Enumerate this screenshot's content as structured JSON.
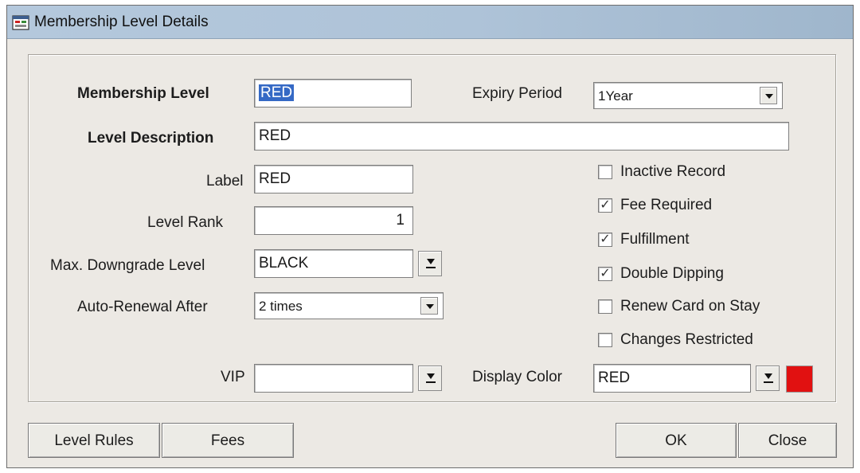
{
  "window": {
    "title": "Membership Level Details"
  },
  "form": {
    "membership_level": {
      "label": "Membership Level",
      "value": "RED"
    },
    "expiry_period": {
      "label": "Expiry Period",
      "value": "1Year"
    },
    "level_description": {
      "label": "Level Description",
      "value": "RED"
    },
    "label": {
      "label": "Label",
      "value": "RED"
    },
    "level_rank": {
      "label": "Level Rank",
      "value": "1"
    },
    "max_downgrade_level": {
      "label": "Max. Downgrade Level",
      "value": "BLACK"
    },
    "auto_renewal_after": {
      "label": "Auto-Renewal After",
      "value": "2 times"
    },
    "vip": {
      "label": "VIP",
      "value": ""
    },
    "display_color": {
      "label": "Display Color",
      "value": "RED",
      "swatch": "#e11111"
    }
  },
  "checkboxes": [
    {
      "label": "Inactive Record",
      "checked": false
    },
    {
      "label": "Fee Required",
      "checked": true
    },
    {
      "label": "Fulfillment",
      "checked": true
    },
    {
      "label": "Double Dipping",
      "checked": true
    },
    {
      "label": "Renew Card on Stay",
      "checked": false
    },
    {
      "label": "Changes Restricted",
      "checked": false
    }
  ],
  "check_mark": "☑",
  "buttons": {
    "level_rules": "Level Rules",
    "fees": "Fees",
    "ok": "OK",
    "close": "Close"
  }
}
